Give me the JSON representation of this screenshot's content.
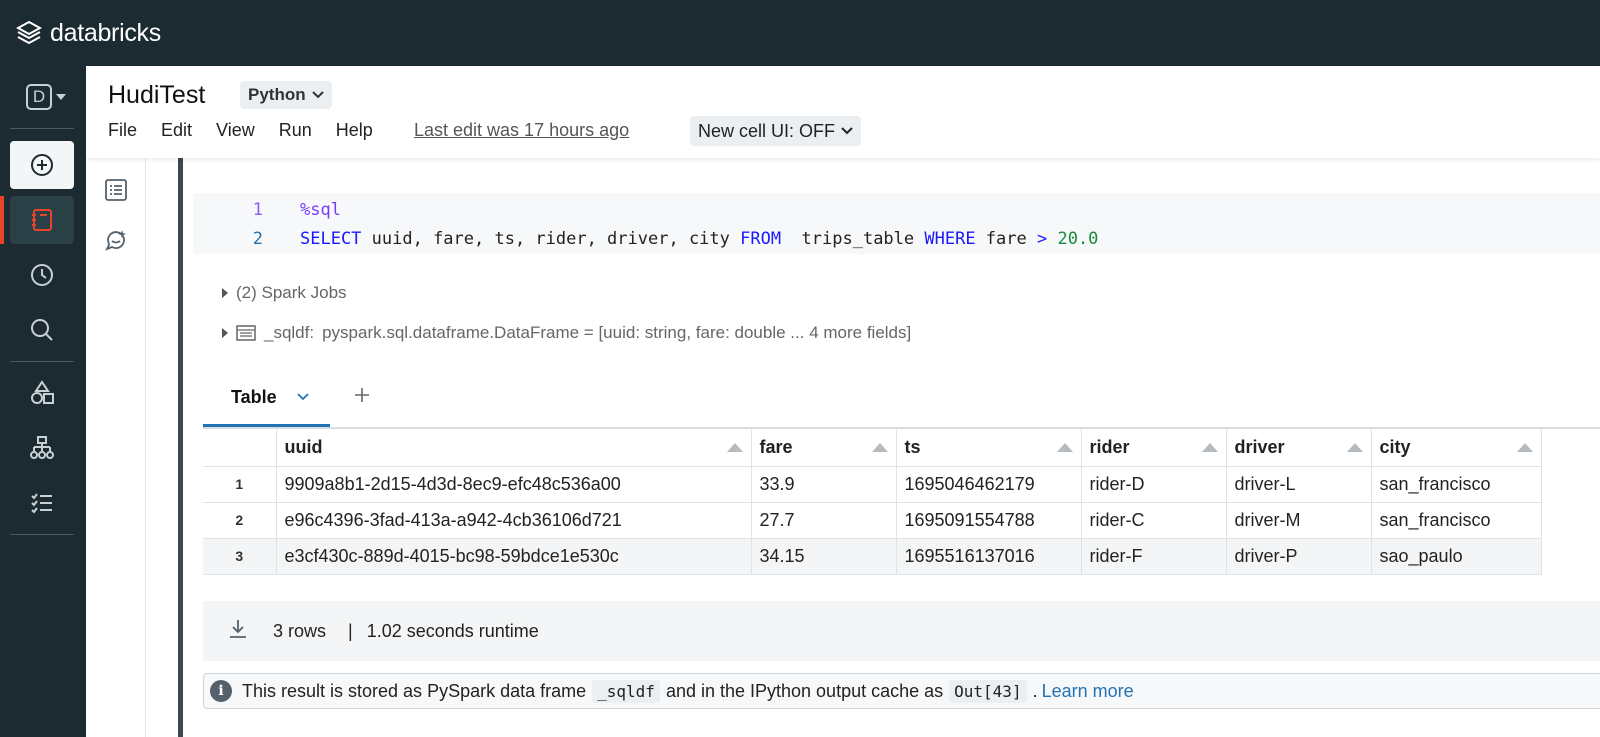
{
  "brand": {
    "name": "databricks"
  },
  "sidebar": {
    "workspace_letter": "D",
    "items": [
      {
        "name": "new",
        "icon": "plus-circle-icon"
      },
      {
        "name": "workspace",
        "icon": "notebook-icon",
        "active": true
      },
      {
        "name": "recents",
        "icon": "clock-icon"
      },
      {
        "name": "search",
        "icon": "search-icon"
      },
      {
        "name": "catalog",
        "icon": "shapes-icon"
      },
      {
        "name": "workflows",
        "icon": "workflow-icon"
      },
      {
        "name": "tasks",
        "icon": "checklist-icon"
      }
    ]
  },
  "notebook": {
    "title": "HudiTest",
    "language": "Python",
    "menu": [
      "File",
      "Edit",
      "View",
      "Run",
      "Help"
    ],
    "last_edit": "Last edit was 17 hours ago",
    "new_cell_ui": "New cell UI: OFF"
  },
  "cell": {
    "lines": [
      {
        "no": "1",
        "magic": "%sql"
      },
      {
        "no": "2",
        "kw1": "SELECT",
        "cols": " uuid, fare, ts, rider, driver, city ",
        "kw2": "FROM",
        "table": "  trips_table ",
        "kw3": "WHERE",
        "cond": " fare ",
        "op": ">",
        "val": " 20.0"
      }
    ],
    "spark_jobs": "(2) Spark Jobs",
    "df_name": "_sqldf:",
    "df_schema": "pyspark.sql.dataframe.DataFrame = [uuid: string, fare: double ... 4 more fields]"
  },
  "result": {
    "tab_label": "Table",
    "columns": [
      "uuid",
      "fare",
      "ts",
      "rider",
      "driver",
      "city"
    ],
    "rows": [
      {
        "idx": "1",
        "uuid": "9909a8b1-2d15-4d3d-8ec9-efc48c536a00",
        "fare": "33.9",
        "ts": "1695046462179",
        "rider": "rider-D",
        "driver": "driver-L",
        "city": "san_francisco"
      },
      {
        "idx": "2",
        "uuid": "e96c4396-3fad-413a-a942-4cb36106d721",
        "fare": "27.7",
        "ts": "1695091554788",
        "rider": "rider-C",
        "driver": "driver-M",
        "city": "san_francisco"
      },
      {
        "idx": "3",
        "uuid": "e3cf430c-889d-4015-bc98-59bdce1e530c",
        "fare": "34.15",
        "ts": "1695516137016",
        "rider": "rider-F",
        "driver": "driver-P",
        "city": "sao_paulo"
      }
    ],
    "row_count": "3 rows",
    "separator": "|",
    "runtime": "1.02 seconds runtime"
  },
  "info": {
    "text1": "This result is stored as PySpark data frame",
    "code1": "_sqldf",
    "text2": "and in the IPython output cache as",
    "code2": "Out[43]",
    "text3": ".",
    "link": "Learn more"
  }
}
